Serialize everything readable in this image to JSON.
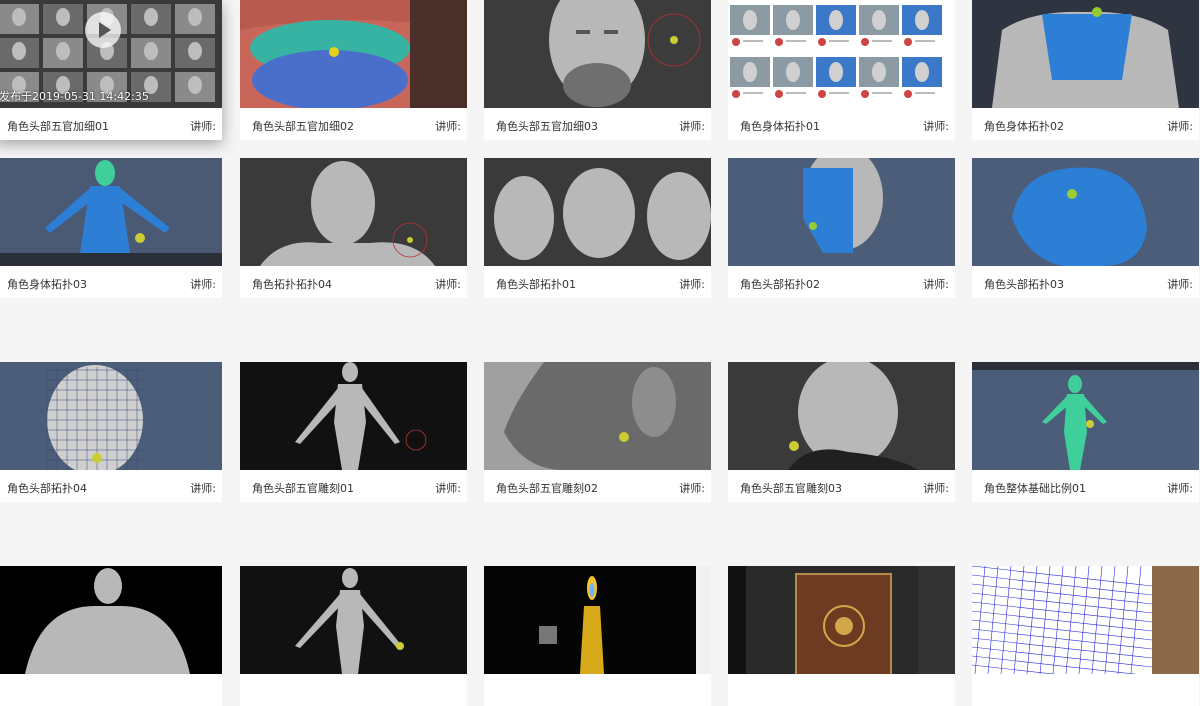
{
  "teacher_label": "讲师:",
  "hover": {
    "published": "发布于2019-05-31 14:42:35"
  },
  "courses": [
    {
      "title": "角色头部五官加细01",
      "kind": "thumbs",
      "bg": "#3a3a3a"
    },
    {
      "title": "角色头部五官加细02",
      "kind": "topo-face",
      "bg": "#4a3a3a"
    },
    {
      "title": "角色头部五官加细03",
      "kind": "head",
      "bg": "#3c3c3c"
    },
    {
      "title": "角色身体拓扑01",
      "kind": "thumbs-light",
      "bg": "#ffffff"
    },
    {
      "title": "角色身体拓扑02",
      "kind": "torso",
      "bg": "#2e3440"
    },
    {
      "title": "角色身体拓扑03",
      "kind": "body-blue",
      "bg": "#4a5a74"
    },
    {
      "title": "角色拓扑拓扑04",
      "kind": "bust",
      "bg": "#3a3a3a"
    },
    {
      "title": "角色头部拓扑01",
      "kind": "three-heads",
      "bg": "#3a3a3a"
    },
    {
      "title": "角色头部拓扑02",
      "kind": "face-blue",
      "bg": "#4b5d78"
    },
    {
      "title": "角色头部拓扑03",
      "kind": "profile-blue",
      "bg": "#4b5d78"
    },
    {
      "title": "角色头部拓扑04",
      "kind": "wire-head",
      "bg": "#4b5d78"
    },
    {
      "title": "角色头部五官雕刻01",
      "kind": "body-grey",
      "bg": "#111111"
    },
    {
      "title": "角色头部五官雕刻02",
      "kind": "ear",
      "bg": "#5a5a5a"
    },
    {
      "title": "角色头部五官雕刻03",
      "kind": "head-side",
      "bg": "#3a3a3a"
    },
    {
      "title": "角色整体基础比例01",
      "kind": "body-green",
      "bg": "#4b5d78"
    },
    {
      "title": "",
      "kind": "torso-grey",
      "bg": "#000000"
    },
    {
      "title": "",
      "kind": "body-grey2",
      "bg": "#111111"
    },
    {
      "title": "",
      "kind": "candle",
      "bg": "#050505"
    },
    {
      "title": "",
      "kind": "book",
      "bg": "#2a2a2a"
    },
    {
      "title": "",
      "kind": "blueprint",
      "bg": "#ffffff"
    }
  ]
}
